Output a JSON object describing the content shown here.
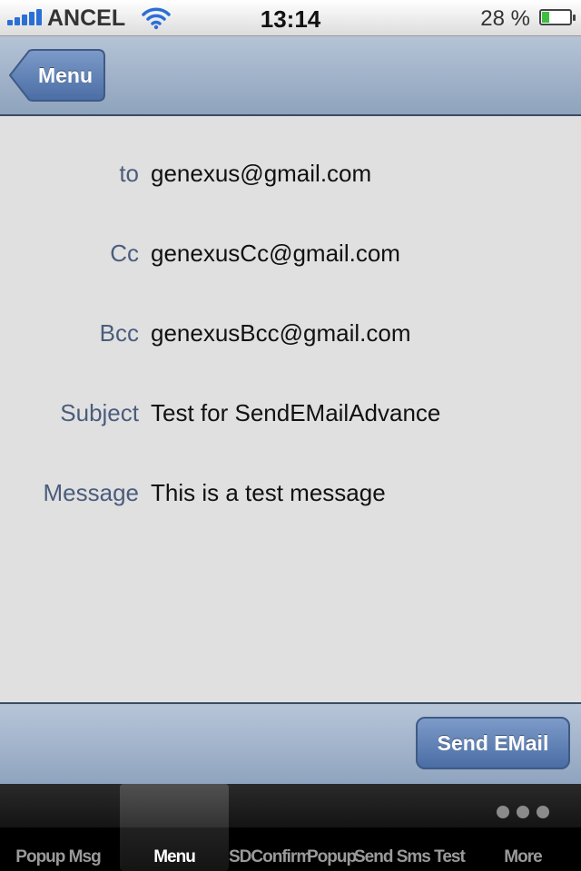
{
  "status_bar": {
    "carrier": "ANCEL",
    "time": "13:14",
    "battery_percent": "28 %",
    "battery_level": 0.28
  },
  "navbar": {
    "back_label": "Menu"
  },
  "form": {
    "fields": [
      {
        "label": "to",
        "value": "genexus@gmail.com"
      },
      {
        "label": "Cc",
        "value": "genexusCc@gmail.com"
      },
      {
        "label": "Bcc",
        "value": "genexusBcc@gmail.com"
      },
      {
        "label": "Subject",
        "value": "Test for SendEMailAdvance"
      },
      {
        "label": "Message",
        "value": "This is a test message"
      }
    ]
  },
  "toolbar": {
    "send_label": "Send EMail"
  },
  "tabs": [
    {
      "label": "Popup Msg",
      "active": false
    },
    {
      "label": "Menu",
      "active": true
    },
    {
      "label": "SDConfirm",
      "active": false
    },
    {
      "label": "Popup",
      "active": false
    },
    {
      "label": "Send Sms Test",
      "active": false
    },
    {
      "label": "More",
      "active": false
    }
  ],
  "colors": {
    "accent": "#4a6da5",
    "label": "#4b5d7d"
  }
}
